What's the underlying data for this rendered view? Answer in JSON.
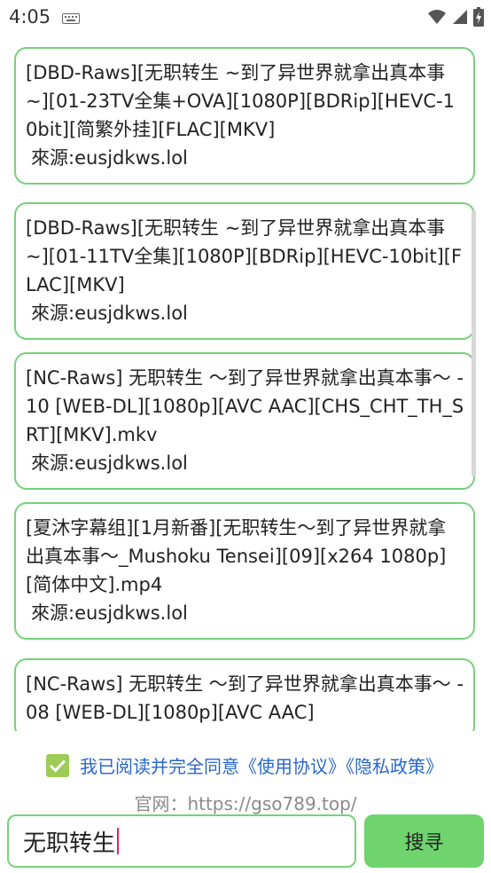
{
  "status_bar": {
    "time": "4:05"
  },
  "results": [
    {
      "title": "[DBD-Raws][无职转生 ~到了异世界就拿出真本事~][01-23TV全集+OVA][1080P][BDRip][HEVC-10bit][简繁外挂][FLAC][MKV]",
      "source": "來源:eusjdkws.lol"
    },
    {
      "title": "[DBD-Raws][无职转生 ~到了异世界就拿出真本事~][01-11TV全集][1080P][BDRip][HEVC-10bit][FLAC][MKV]",
      "source": "來源:eusjdkws.lol"
    },
    {
      "title": "[NC-Raws] 无职转生 〜到了异世界就拿出真本事〜 - 10 [WEB-DL][1080p][AVC AAC][CHS_CHT_TH_SRT][MKV].mkv",
      "source": "來源:eusjdkws.lol"
    },
    {
      "title": "[夏沐字幕组][1月新番][无职转生〜到了异世界就拿出真本事〜_Mushoku Tensei][09][x264 1080p][简体中文].mp4",
      "source": "來源:eusjdkws.lol"
    },
    {
      "title": "[NC-Raws] 无职转生 〜到了异世界就拿出真本事〜 - 08 [WEB-DL][1080p][AVC AAC]",
      "source": ""
    }
  ],
  "agreement": {
    "checked": true,
    "text": "我已阅读并完全同意《使用协议》《隐私政策》"
  },
  "site": {
    "text": "官网：https://gso789.top/"
  },
  "search": {
    "value": "无职转生",
    "button_label": "搜寻"
  },
  "colors": {
    "accent_border": "#76d27a",
    "button": "#6fd46e",
    "link": "#2a67c9",
    "checkbox": "#9ccc57"
  }
}
